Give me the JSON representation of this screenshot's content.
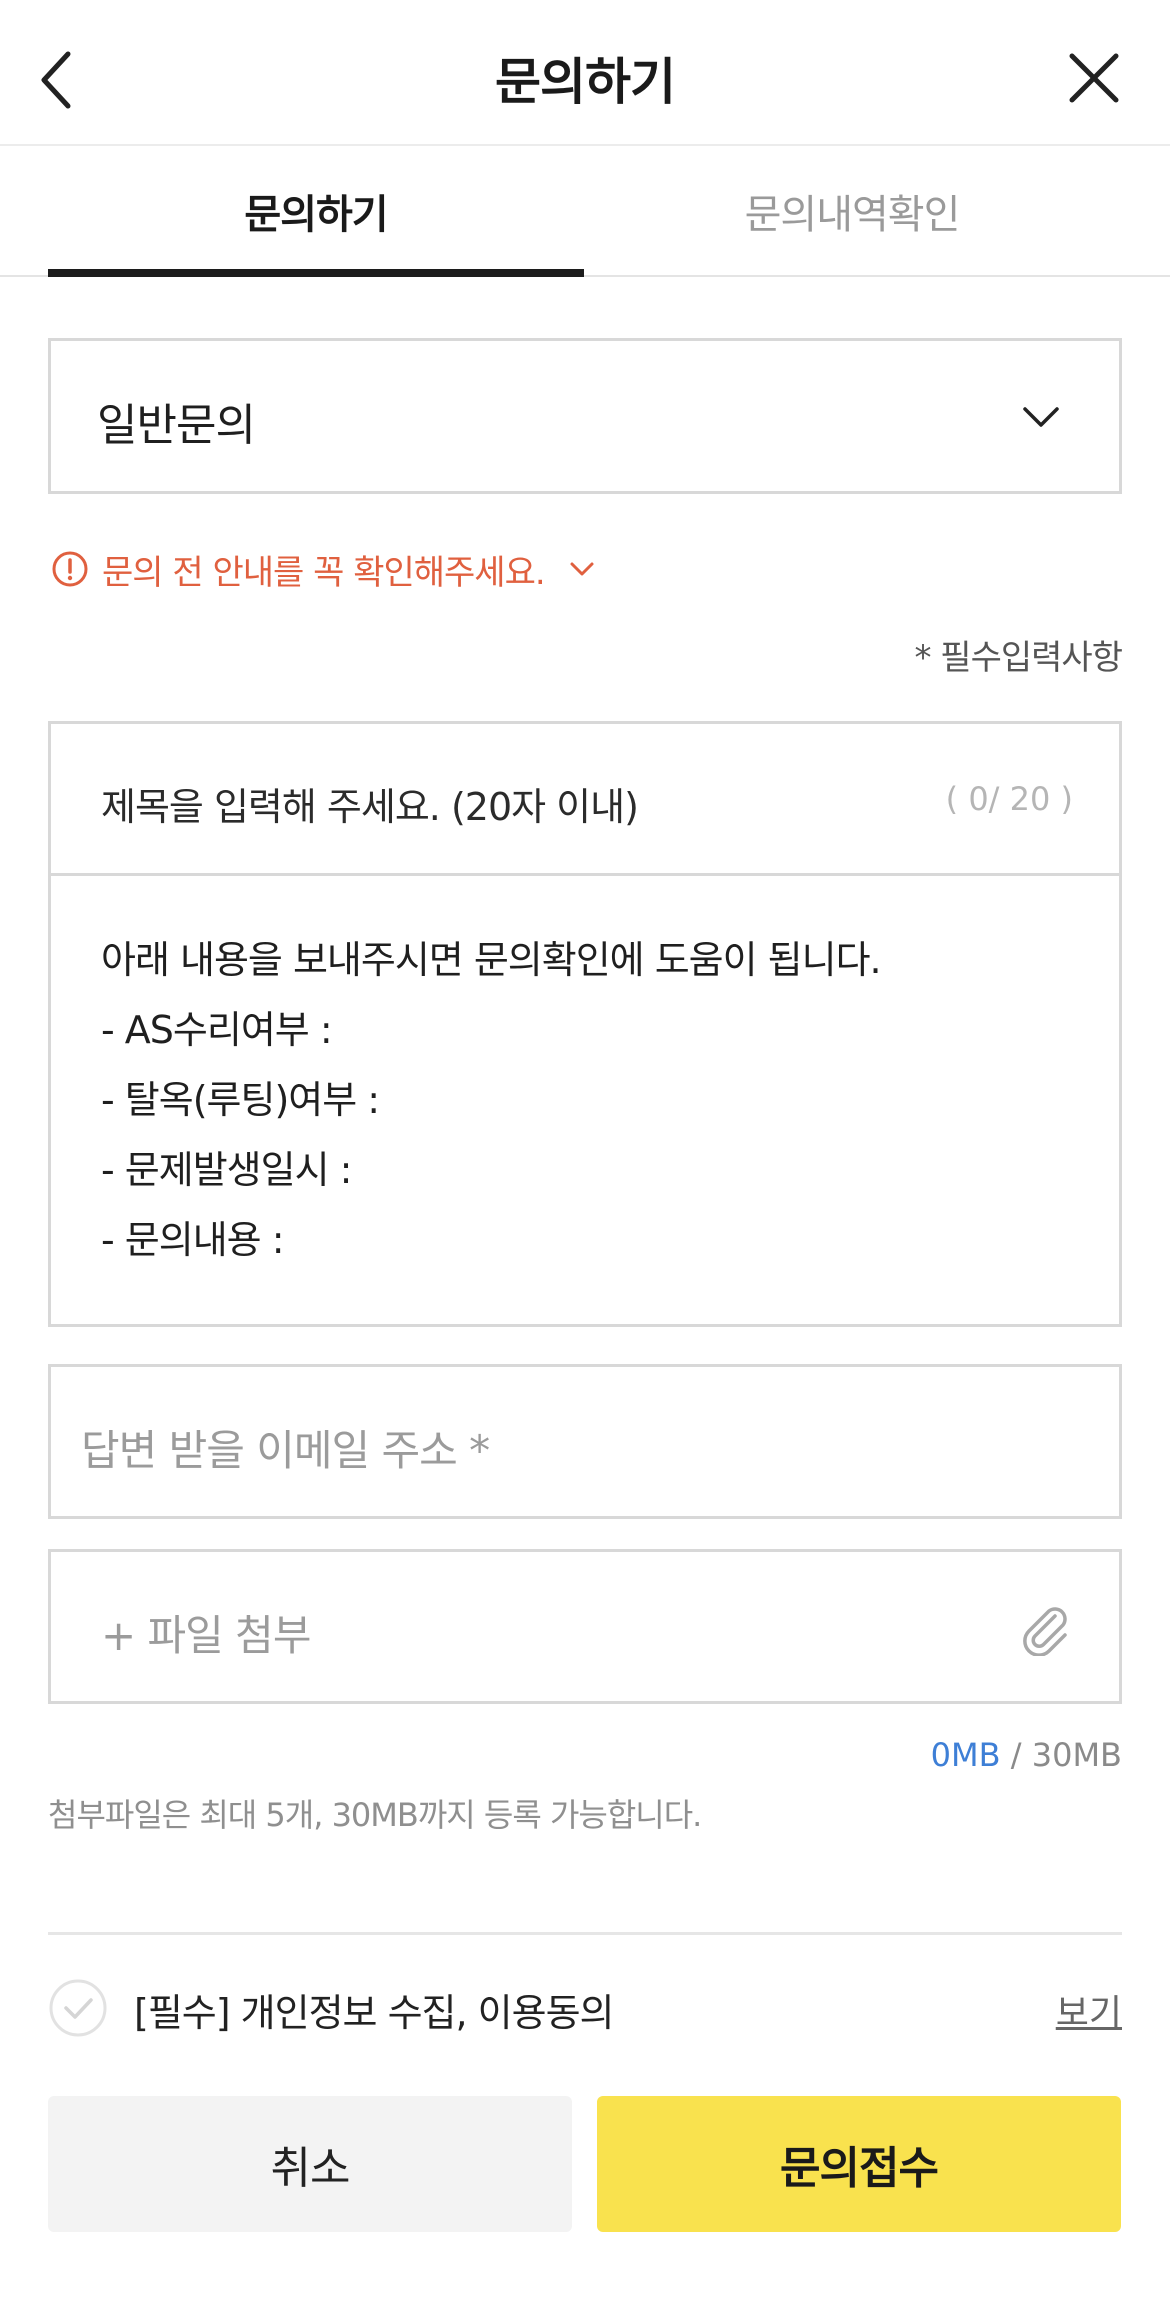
{
  "header": {
    "title": "문의하기",
    "back_icon": "chevron-left-icon",
    "close_icon": "close-icon"
  },
  "tabs": [
    {
      "label": "문의하기",
      "active": true
    },
    {
      "label": "문의내역확인",
      "active": false
    }
  ],
  "category_select": {
    "value": "일반문의",
    "icon": "chevron-down-icon"
  },
  "notice": {
    "text": "문의 전 안내를 꼭 확인해주세요.",
    "color": "#e0603f"
  },
  "required_note": "* 필수입력사항",
  "inquiry": {
    "title_placeholder": "제목을 입력해 주세요. (20자 이내)",
    "title_counter": "( 0/ 20 )",
    "body_lines": [
      "아래 내용을 보내주시면 문의확인에 도움이 됩니다.",
      "- AS수리여부 :",
      "- 탈옥(루팅)여부 :",
      "- 문제발생일시 :",
      "- 문의내용 :"
    ]
  },
  "email": {
    "placeholder": "답변 받을 이메일 주소 *"
  },
  "file": {
    "label": "+ 파일 첨부",
    "icon": "paperclip-icon",
    "used": "0MB",
    "separator": " / ",
    "limit": "30MB",
    "note": "첨부파일은 최대 5개, 30MB까지 등록 가능합니다."
  },
  "agreement": {
    "label": "[필수] 개인정보 수집, 이용동의",
    "view_label": "보기",
    "checked": false
  },
  "buttons": {
    "cancel": "취소",
    "submit": "문의접수"
  },
  "colors": {
    "accent_yellow": "#f9e24e",
    "link_blue": "#3e7fd6",
    "warning_orange": "#e0603f"
  }
}
